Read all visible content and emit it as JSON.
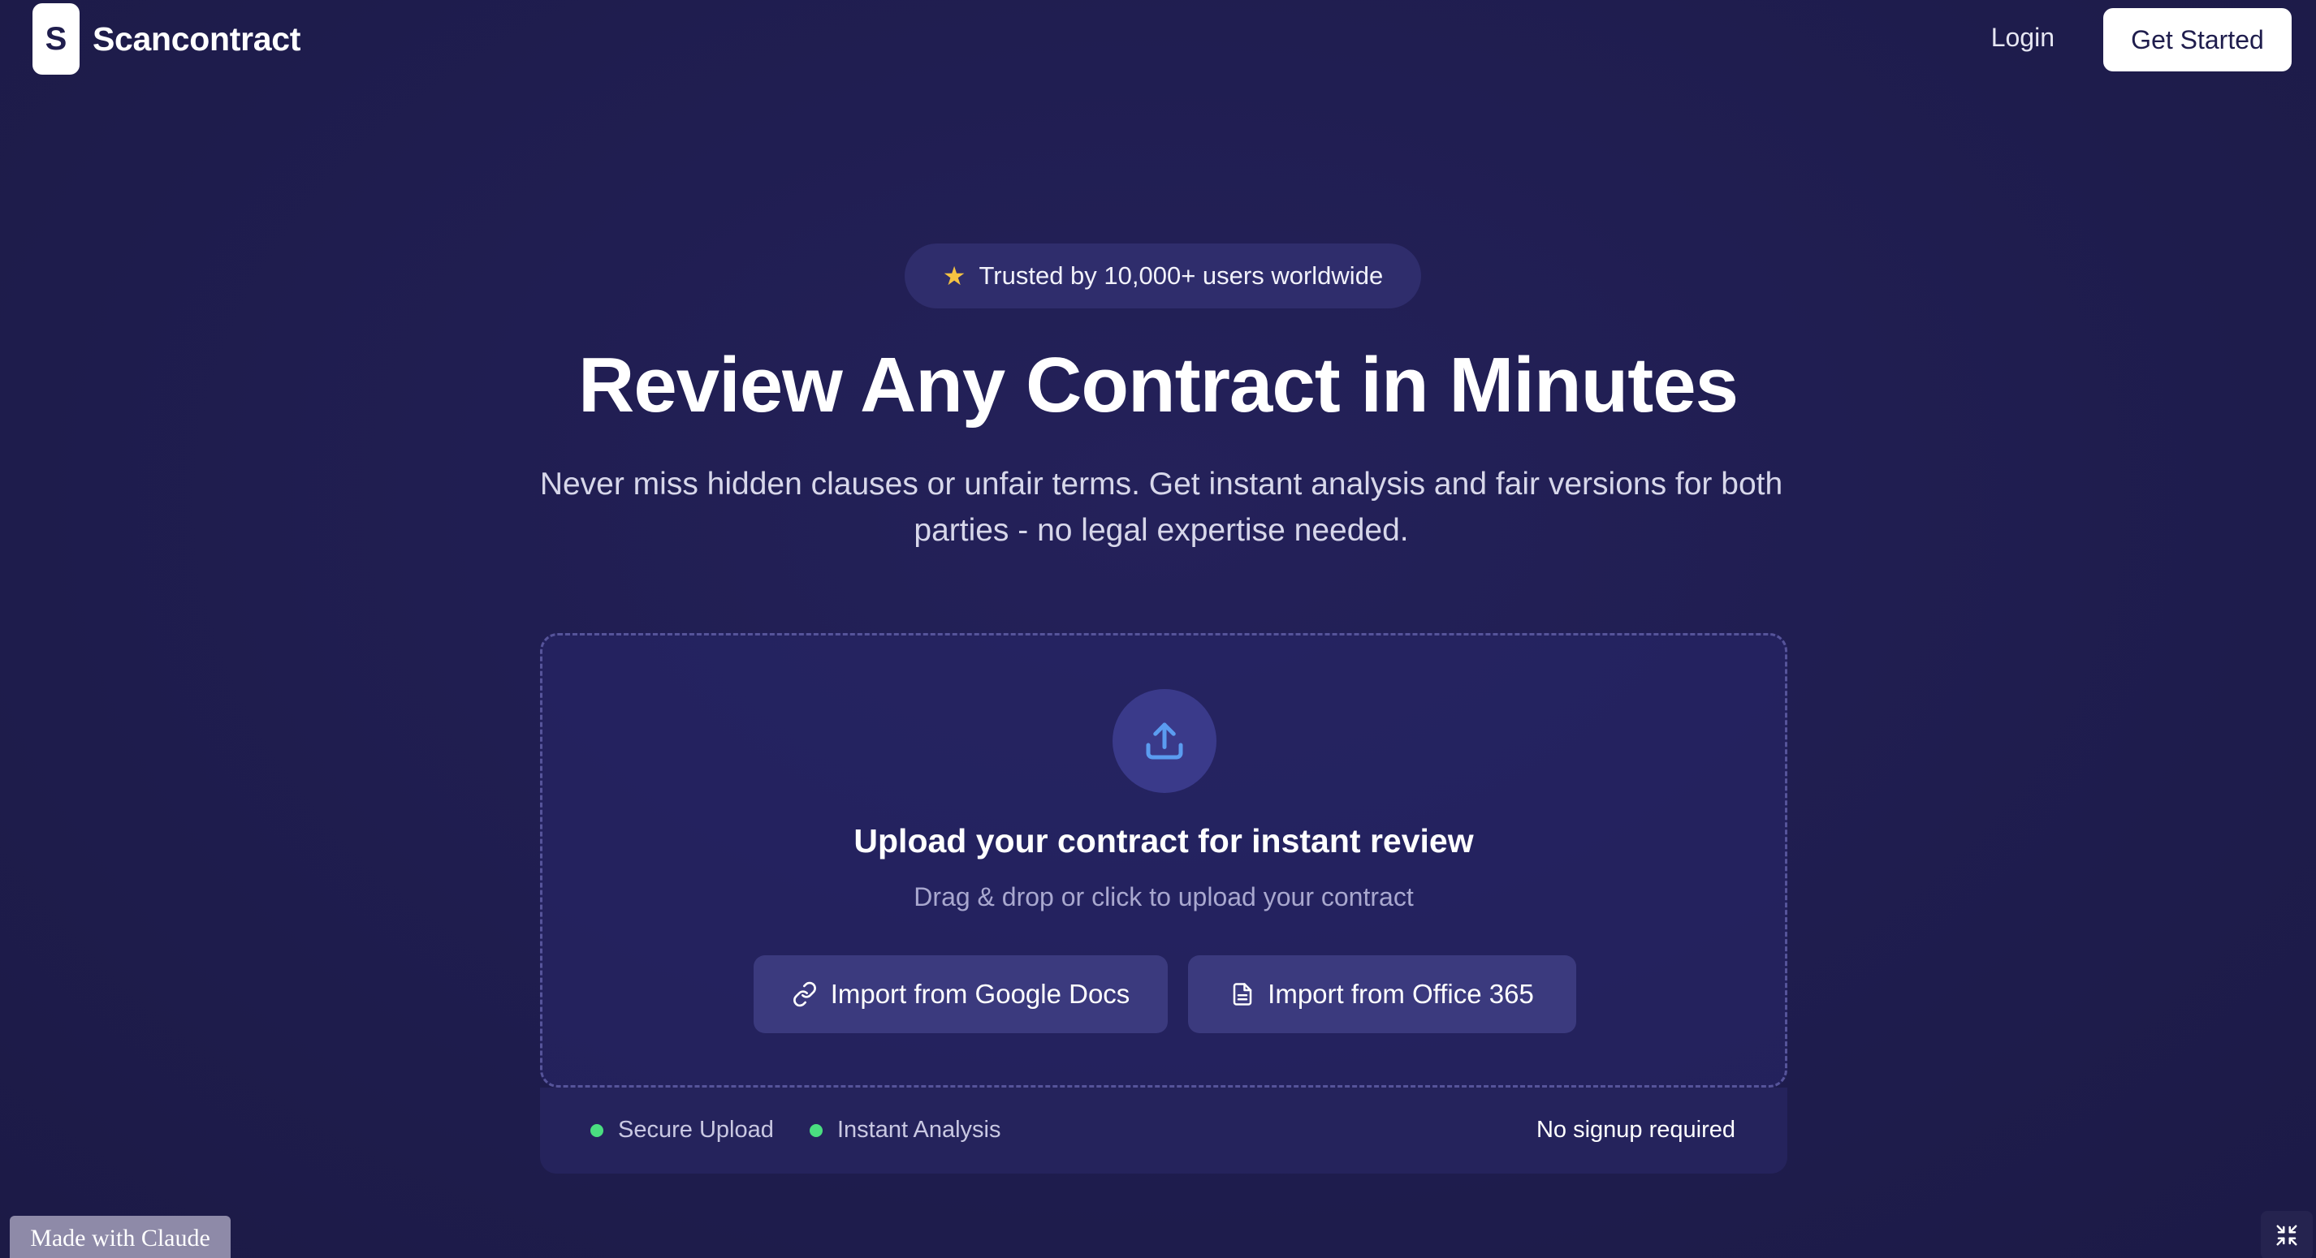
{
  "header": {
    "logo_letter": "S",
    "brand": "Scancontract",
    "login_label": "Login",
    "cta_label": "Get Started"
  },
  "hero": {
    "badge_icon": "star-icon",
    "badge_text": "Trusted by 10,000+ users worldwide",
    "title": "Review Any Contract in Minutes",
    "subtitle": "Never miss hidden clauses or unfair terms. Get instant analysis and fair versions for both parties - no legal expertise needed."
  },
  "upload": {
    "icon": "upload-icon",
    "title": "Upload your contract for instant review",
    "subtitle": "Drag & drop or click to upload your contract",
    "buttons": [
      {
        "icon": "link-icon",
        "label": "Import from Google Docs"
      },
      {
        "icon": "document-icon",
        "label": "Import from Office 365"
      }
    ]
  },
  "features": {
    "items": [
      {
        "label": "Secure Upload"
      },
      {
        "label": "Instant Analysis"
      }
    ],
    "right_text": "No signup required"
  },
  "footer": {
    "made_with": "Made with Claude",
    "collapse_icon": "collapse-icon"
  },
  "colors": {
    "background": "#1f1d4d",
    "badge_bg": "#2f2d6c",
    "star": "#f5c342",
    "accent_blue": "#5b9cf0",
    "status_green": "#4ade80",
    "button_bg": "#3b3a7e"
  }
}
